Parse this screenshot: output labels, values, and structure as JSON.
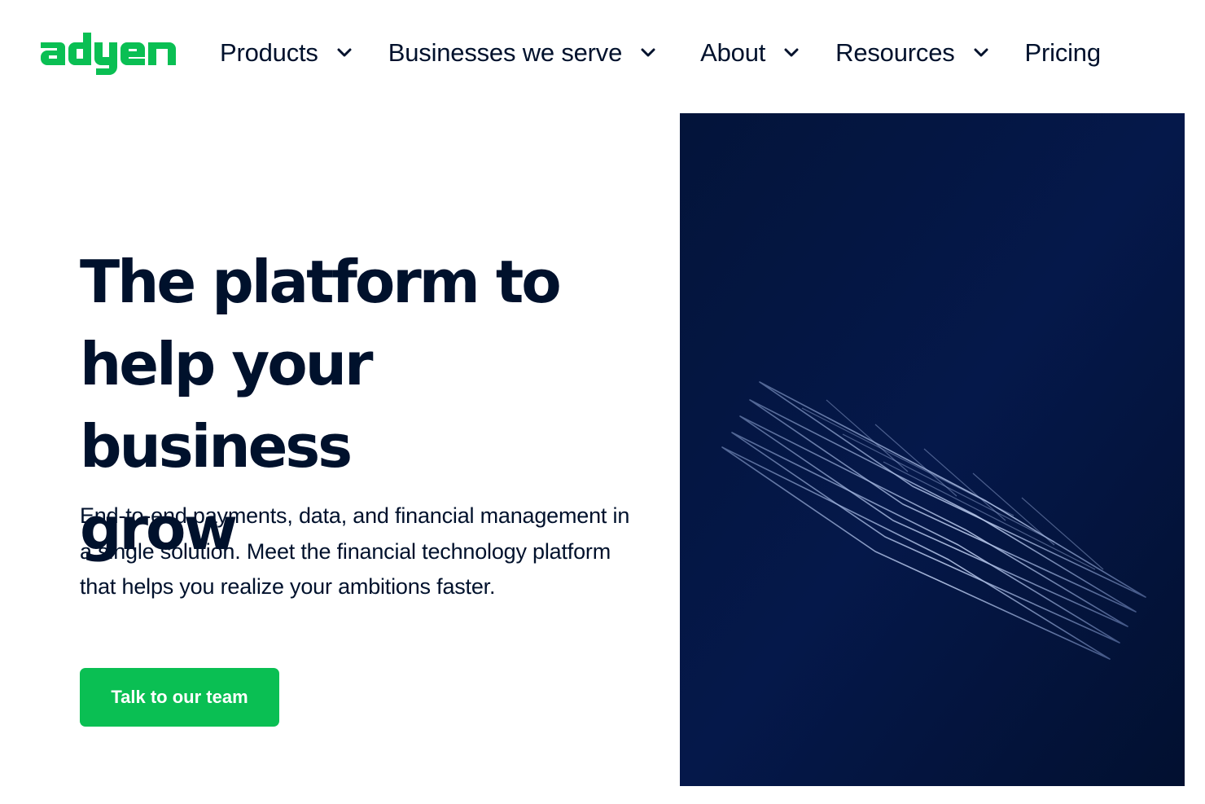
{
  "brand": {
    "logo_text": "adyen",
    "logo_color": "#0abf53"
  },
  "nav": {
    "items": [
      {
        "label": "Products",
        "has_dropdown": true
      },
      {
        "label": "Businesses we serve",
        "has_dropdown": true
      },
      {
        "label": "About",
        "has_dropdown": true
      },
      {
        "label": "Resources",
        "has_dropdown": true
      },
      {
        "label": "Pricing",
        "has_dropdown": false
      }
    ],
    "dropdown_icon": "chevron-down-icon"
  },
  "hero": {
    "title_lines": [
      "The platform to",
      "help your business",
      "grow"
    ],
    "subtitle": "End-to-end payments, data, and financial management in a single solution. Meet the financial technology platform that helps you realize your ambitions faster.",
    "cta_label": "Talk to our team",
    "cta_color": "#0abf53",
    "visual": {
      "description_icon": "wireframe-layers-illustration",
      "background_color": "#04143a"
    }
  },
  "colors": {
    "text": "#00112c",
    "accent": "#0abf53",
    "background": "#ffffff"
  }
}
